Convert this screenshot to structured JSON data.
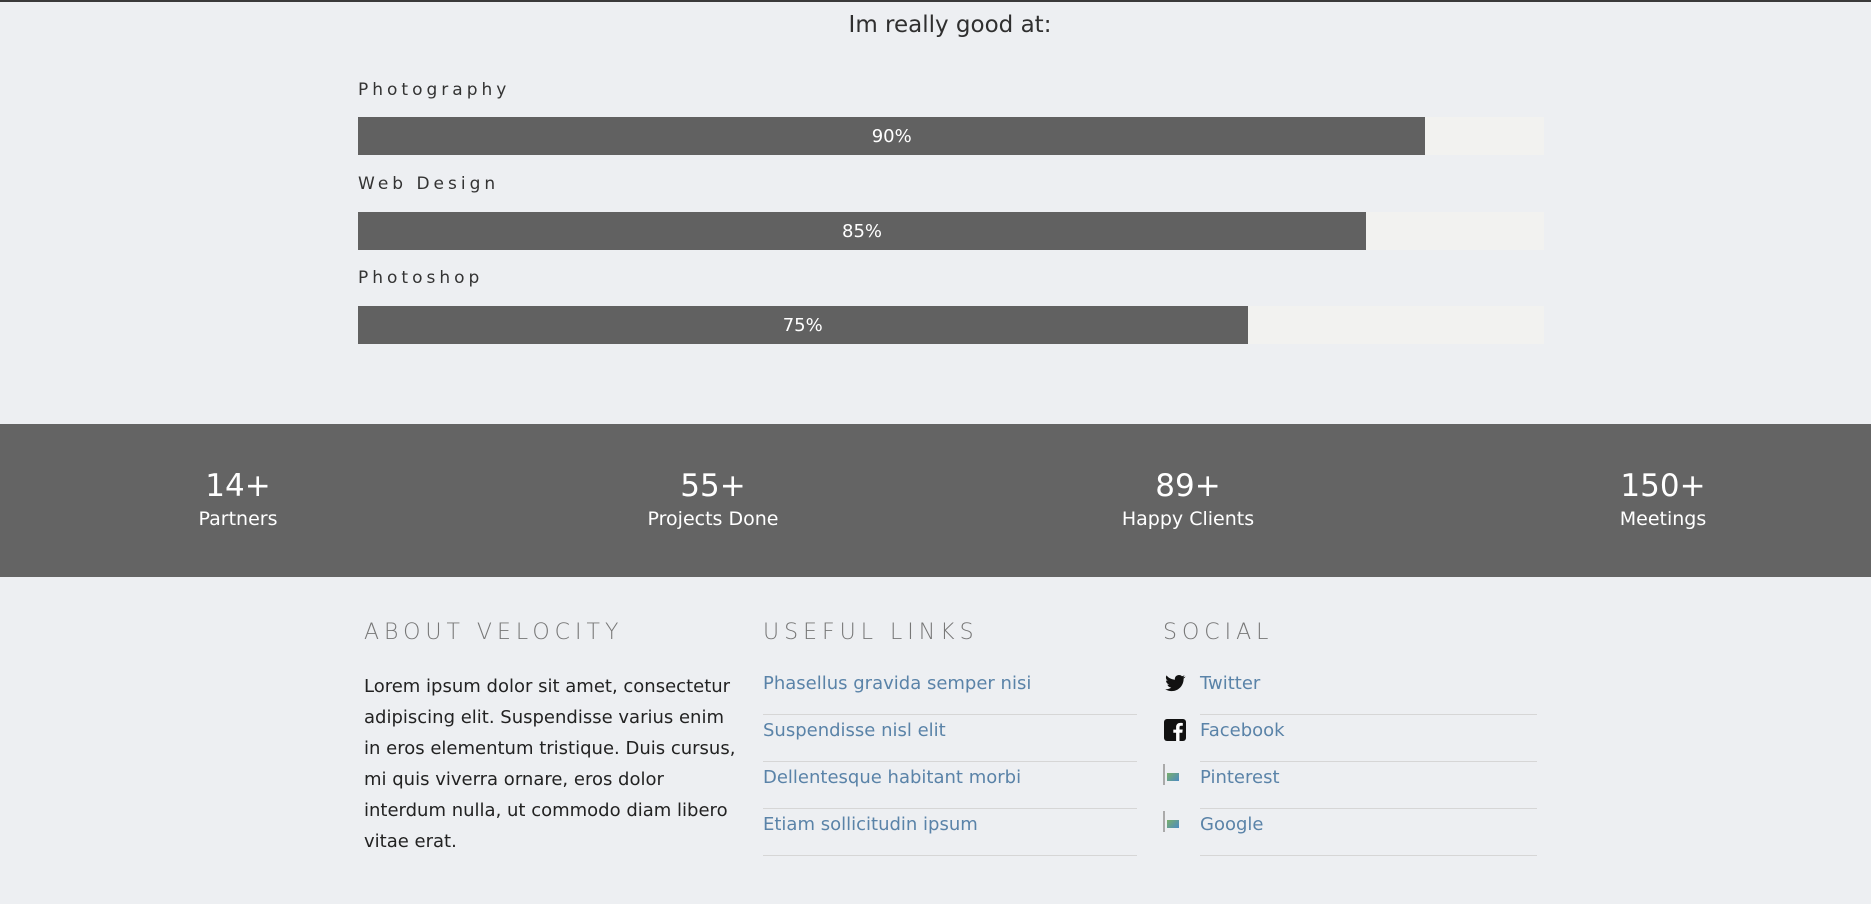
{
  "skills": {
    "title": "Im really good at:",
    "items": [
      {
        "label": "Photography",
        "percent": 90,
        "text": "90%"
      },
      {
        "label": "Web Design",
        "percent": 85,
        "text": "85%"
      },
      {
        "label": "Photoshop",
        "percent": 75,
        "text": "75%"
      }
    ]
  },
  "stats": [
    {
      "number": "14+",
      "label": "Partners"
    },
    {
      "number": "55+",
      "label": "Projects Done"
    },
    {
      "number": "89+",
      "label": "Happy Clients"
    },
    {
      "number": "150+",
      "label": "Meetings"
    }
  ],
  "footer": {
    "about": {
      "heading": "About Velocity",
      "text": "Lorem ipsum dolor sit amet, consectetur adipiscing elit. Suspendisse varius enim in eros elementum tristique. Duis cursus, mi quis viverra ornare, eros dolor interdum nulla, ut commodo diam libero vitae erat."
    },
    "links": {
      "heading": "Useful Links",
      "items": [
        "Phasellus gravida semper nisi",
        "Suspendisse nisl elit",
        "Dellentesque habitant morbi",
        "Etiam sollicitudin ipsum"
      ]
    },
    "social": {
      "heading": "Social",
      "items": [
        {
          "label": "Twitter",
          "icon": "twitter-icon"
        },
        {
          "label": "Facebook",
          "icon": "facebook-icon"
        },
        {
          "label": "Pinterest",
          "icon": "broken-image-icon"
        },
        {
          "label": "Google",
          "icon": "broken-image-icon"
        }
      ]
    }
  },
  "colors": {
    "bar": "#616161",
    "stats_bg": "#646464",
    "link": "#5a83a8"
  }
}
